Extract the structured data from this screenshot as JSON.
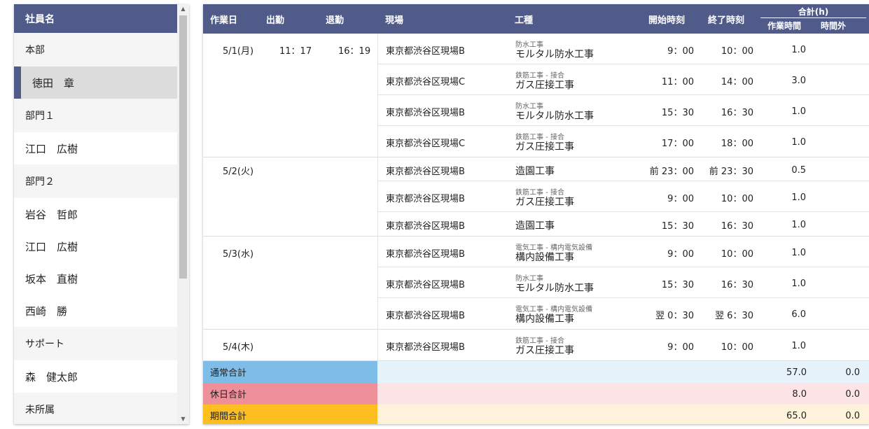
{
  "sidebar": {
    "header": "社員名",
    "items": [
      {
        "type": "group",
        "label": "本部"
      },
      {
        "type": "person",
        "label": "徳田　章",
        "selected": true
      },
      {
        "type": "group",
        "label": "部門１"
      },
      {
        "type": "person",
        "label": "江口　広樹"
      },
      {
        "type": "group",
        "label": "部門２"
      },
      {
        "type": "person",
        "label": "岩谷　哲郎"
      },
      {
        "type": "person",
        "label": "江口　広樹"
      },
      {
        "type": "person",
        "label": "坂本　直樹"
      },
      {
        "type": "person",
        "label": "西崎　勝"
      },
      {
        "type": "group",
        "label": "サポート"
      },
      {
        "type": "person",
        "label": "森　健太郎"
      },
      {
        "type": "group",
        "label": "未所属"
      }
    ]
  },
  "table": {
    "headers": {
      "date": "作業日",
      "clock_in": "出勤",
      "clock_out": "退勤",
      "site": "現場",
      "trade": "工種",
      "start": "開始時刻",
      "end": "終了時刻",
      "sum": "合計(h)",
      "work_hours": "作業時間",
      "overtime": "時間外"
    },
    "days": [
      {
        "date": "5/1(月)",
        "clock_in": "11：17",
        "clock_out": "16：19",
        "rows": [
          {
            "site": "東京都渋谷区現場B",
            "category": "防水工事",
            "trade": "モルタル防水工事",
            "start": "9：00",
            "end": "10：00",
            "hours": "1.0"
          },
          {
            "site": "東京都渋谷区現場C",
            "category": "鉄筋工事 - 接合",
            "trade": "ガス圧接工事",
            "start": "11：00",
            "end": "14：00",
            "hours": "3.0"
          },
          {
            "site": "東京都渋谷区現場B",
            "category": "防水工事",
            "trade": "モルタル防水工事",
            "start": "15：30",
            "end": "16：30",
            "hours": "1.0"
          },
          {
            "site": "東京都渋谷区現場C",
            "category": "鉄筋工事 - 接合",
            "trade": "ガス圧接工事",
            "start": "17：00",
            "end": "18：00",
            "hours": "1.0"
          }
        ]
      },
      {
        "date": "5/2(火)",
        "clock_in": "",
        "clock_out": "",
        "rows": [
          {
            "site": "東京都渋谷区現場B",
            "category": "",
            "trade": "造園工事",
            "start": "前 23：00",
            "end": "前 23：30",
            "hours": "0.5"
          },
          {
            "site": "東京都渋谷区現場B",
            "category": "鉄筋工事 - 接合",
            "trade": "ガス圧接工事",
            "start": "9：00",
            "end": "10：00",
            "hours": "1.0"
          },
          {
            "site": "東京都渋谷区現場B",
            "category": "",
            "trade": "造園工事",
            "start": "15：30",
            "end": "16：30",
            "hours": "1.0"
          }
        ]
      },
      {
        "date": "5/3(水)",
        "clock_in": "",
        "clock_out": "",
        "rows": [
          {
            "site": "東京都渋谷区現場B",
            "category": "電気工事 - 構内電気設備",
            "trade": "構内設備工事",
            "start": "9：00",
            "end": "10：00",
            "hours": "1.0"
          },
          {
            "site": "東京都渋谷区現場B",
            "category": "防水工事",
            "trade": "モルタル防水工事",
            "start": "15：30",
            "end": "16：30",
            "hours": "1.0"
          },
          {
            "site": "東京都渋谷区現場B",
            "category": "電気工事 - 構内電気設備",
            "trade": "構内設備工事",
            "start": "翌 0：30",
            "end": "翌 6：30",
            "hours": "6.0"
          }
        ]
      },
      {
        "date": "5/4(木)",
        "clock_in": "",
        "clock_out": "",
        "rows": [
          {
            "site": "東京都渋谷区現場B",
            "category": "鉄筋工事 - 接合",
            "trade": "ガス圧接工事",
            "start": "9：00",
            "end": "10：00",
            "hours": "1.0"
          }
        ]
      }
    ],
    "totals": [
      {
        "label": "通常合計",
        "work": "57.0",
        "overtime": "0.0",
        "label_color": "#7dbde8",
        "fill_color": "#e7f3fb"
      },
      {
        "label": "休日合計",
        "work": "8.0",
        "overtime": "0.0",
        "label_color": "#ef8f9a",
        "fill_color": "#fde4e7"
      },
      {
        "label": "期間合計",
        "work": "65.0",
        "overtime": "0.0",
        "label_color": "#fcbf1f",
        "fill_color": "#fef3da"
      }
    ]
  }
}
